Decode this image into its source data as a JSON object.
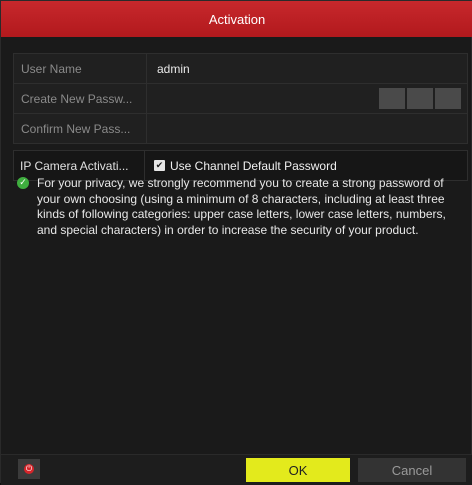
{
  "window": {
    "title": "Activation"
  },
  "form": {
    "user_name": {
      "label": "User Name",
      "value": "admin"
    },
    "create_password": {
      "label": "Create New Passw...",
      "value": ""
    },
    "confirm_password": {
      "label": "Confirm New Pass...",
      "value": ""
    },
    "ip_camera": {
      "label": "IP Camera Activati...",
      "checkbox_label": "Use Channel Default Password",
      "checked": true
    }
  },
  "notice": {
    "text": "For your privacy, we strongly recommend you to create a strong password of your own choosing (using a minimum of 8 characters, including at least three kinds of following categories: upper case letters, lower case letters, numbers, and special characters) in order to increase the security of your product."
  },
  "buttons": {
    "ok": "OK",
    "cancel": "Cancel"
  },
  "colors": {
    "title_bg": "#c7282c",
    "ok_bg": "#e3ea1c",
    "notice_icon": "#3fae3f"
  }
}
